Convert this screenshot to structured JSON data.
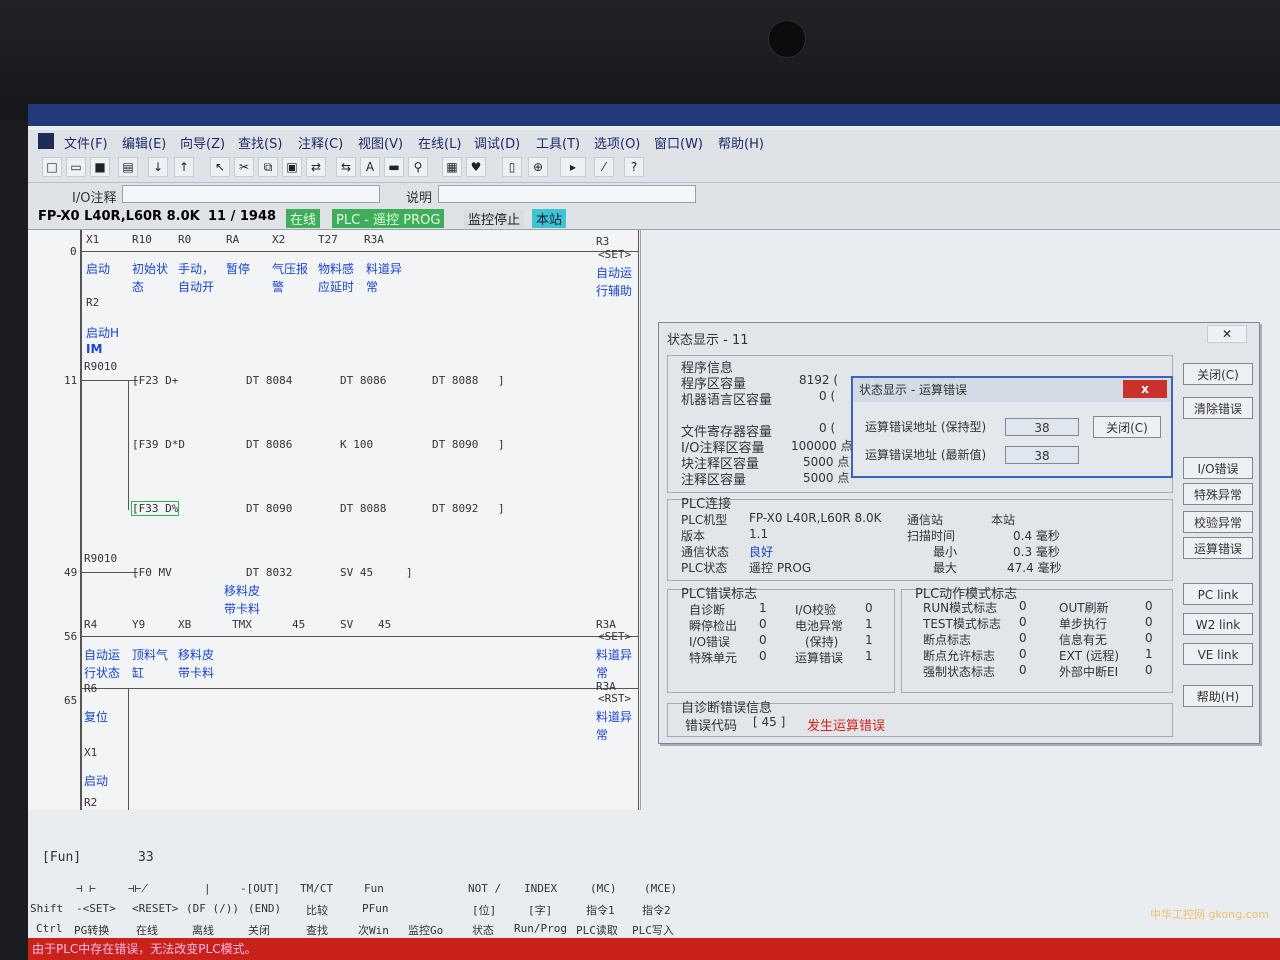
{
  "menu": [
    "文件(F)",
    "编辑(E)",
    "向导(Z)",
    "查找(S)",
    "注释(C)",
    "视图(V)",
    "在线(L)",
    "调试(D)",
    "工具(T)",
    "选项(O)",
    "窗口(W)",
    "帮助(H)"
  ],
  "io": {
    "label": "I/O注释",
    "desc_label": "说明"
  },
  "status": {
    "model": "FP-X0 L40R,L60R 8.0K",
    "steps": "11 / 1948",
    "online": "在线",
    "plc_mode": "PLC - 遥控 PROG",
    "monitor": "监控停止",
    "station": "本站"
  },
  "ladder": {
    "r0": {
      "addr": "0",
      "c1": "X1",
      "c2": "R10",
      "c3": "R0",
      "c4": "RA",
      "c5": "X2",
      "c6": "T27",
      "c7": "R3A",
      "out": "R3",
      "set": "<SET>",
      "m1": "启动",
      "m2a": "初始状",
      "m2b": "态",
      "m3a": "手动，",
      "m3b": "自动开",
      "m4": "暂停",
      "m5a": "气压报",
      "m5b": "警",
      "m6a": "物料感",
      "m6b": "应延时",
      "m7a": "料道异",
      "m7b": "常",
      "oa": "自动运",
      "ob": "行辅助",
      "r2": "R2",
      "r2a": "启动H",
      "r2b": "IM"
    },
    "r11": {
      "addr": "11",
      "c": "R9010",
      "f1": "[F23 D+",
      "a1": "DT 8084",
      "b1": "DT 8086",
      "d1": "DT 8088",
      "f2": "[F39 D*D",
      "a2": "DT 8086",
      "b2": "K 100",
      "d2": "DT 8090",
      "f3": "[F33 D%",
      "a3": "DT 8090",
      "b3": "DT 8088",
      "d3": "DT 8092",
      "br": "]"
    },
    "r49": {
      "addr": "49",
      "c": "R9010",
      "f": "[F0 MV",
      "a": "DT 8032",
      "b": "SV 45",
      "br": "]",
      "ma": "移料皮",
      "mb": "带卡料"
    },
    "r56": {
      "addr": "56",
      "c1": "R4",
      "c2": "Y9",
      "c3": "XB",
      "tmx": "TMX",
      "n": "45",
      "sv": "SV",
      "n2": "45",
      "out": "R3A",
      "set": "<SET>",
      "m1a": "自动运",
      "m1b": "行状态",
      "m2a": "顶料气",
      "m2b": "缸",
      "m3a": "移料皮",
      "m3b": "带卡料",
      "oa": "料道异",
      "ob": "常"
    },
    "r65": {
      "addr": "65",
      "c": "R6",
      "m": "复位",
      "out": "R3A",
      "rst": "<RST>",
      "oa": "料道异",
      "ob": "常",
      "c2": "X1",
      "m2": "启动",
      "c3": "R2"
    }
  },
  "keys": {
    "fun": "[Fun]",
    "fun_val": "33",
    "r1": [
      "⊣ ⊢",
      "⊣⊬",
      "|",
      "-[OUT]",
      "TM/CT",
      "Fun",
      "NOT /",
      "INDEX",
      "(MC)",
      "(MCE)"
    ],
    "shift": [
      "Shift",
      "-<SET>",
      "<RESET>",
      "(DF (/))",
      "(END)",
      "比较",
      "PFun",
      "[位]",
      "[字]",
      "指令1",
      "指令2"
    ],
    "ctrl": [
      "Ctrl",
      "PG转换",
      "在线",
      "离线",
      "关闭",
      "查找",
      "次Win",
      "监控Go",
      "状态",
      "Run/Prog",
      "PLC读取",
      "PLC写入"
    ]
  },
  "message": "由于PLC中存在错误，无法改变PLC模式。",
  "dialog": {
    "title": "状态显示 - 11",
    "prog_title": "程序信息",
    "prog": [
      {
        "k": "程序区容量",
        "v": "8192 ("
      },
      {
        "k": "机器语言区容量",
        "v": "0 ("
      },
      {
        "k": "文件寄存器容量",
        "v": "0 ("
      },
      {
        "k": "I/O注释区容量",
        "v": "100000 点"
      },
      {
        "k": "块注释区容量",
        "v": "5000 点"
      },
      {
        "k": "注释区容量",
        "v": "5000 点"
      }
    ],
    "conn_title": "PLC连接",
    "conn": [
      {
        "k": "PLC机型",
        "v": "FP-X0 L40R,L60R 8.0K"
      },
      {
        "k": "版本",
        "v": "1.1"
      },
      {
        "k": "通信状态",
        "v": "良好"
      },
      {
        "k": "PLC状态",
        "v": "遥控 PROG"
      }
    ],
    "conn2": [
      {
        "k": "通信站",
        "v": "本站"
      },
      {
        "k": "扫描时间",
        "v": "0.4 毫秒"
      },
      {
        "k": "最小",
        "v": "0.3 毫秒"
      },
      {
        "k": "最大",
        "v": "47.4 毫秒"
      }
    ],
    "errflag_title": "PLC错误标志",
    "errflags": [
      {
        "k": "自诊断",
        "v": "1"
      },
      {
        "k": "瞬停检出",
        "v": "0"
      },
      {
        "k": "I/O错误",
        "v": "0"
      },
      {
        "k": "特殊单元",
        "v": "0"
      }
    ],
    "errflags2": [
      {
        "k": "I/O校验",
        "v": "0"
      },
      {
        "k": "电池异常",
        "v": "1"
      },
      {
        "k": "(保持)",
        "v": "1"
      },
      {
        "k": "运算错误",
        "v": "1"
      }
    ],
    "mode_title": "PLC动作模式标志",
    "mode": [
      {
        "k": "RUN模式标志",
        "v": "0"
      },
      {
        "k": "TEST模式标志",
        "v": "0"
      },
      {
        "k": "断点标志",
        "v": "0"
      },
      {
        "k": "断点允许标志",
        "v": "0"
      },
      {
        "k": "强制状态标志",
        "v": "0"
      }
    ],
    "mode2": [
      {
        "k": "OUT刷新",
        "v": "0"
      },
      {
        "k": "单步执行",
        "v": "0"
      },
      {
        "k": "信息有无",
        "v": "0"
      },
      {
        "k": "EXT (远程)",
        "v": "1"
      },
      {
        "k": "外部中断EI",
        "v": "0"
      }
    ],
    "diag_title": "自诊断错误信息",
    "diag_label": "错误代码",
    "diag_code": "[ 45 ]",
    "diag_msg": "发生运算错误",
    "buttons": [
      "关闭(C)",
      "清除错误",
      "I/O错误",
      "特殊异常",
      "校验异常",
      "运算错误",
      "PC link",
      "W2 link",
      "VE link",
      "帮助(H)"
    ]
  },
  "err_dialog": {
    "title": "状态显示 - 运算错误",
    "close_x": "x",
    "f1_label": "运算错误地址 (保持型)",
    "f1_val": "38",
    "f2_label": "运算错误地址 (最新值)",
    "f2_val": "38",
    "close_btn": "关闭(C)"
  },
  "watermark": "中华工控网 gkong.com"
}
